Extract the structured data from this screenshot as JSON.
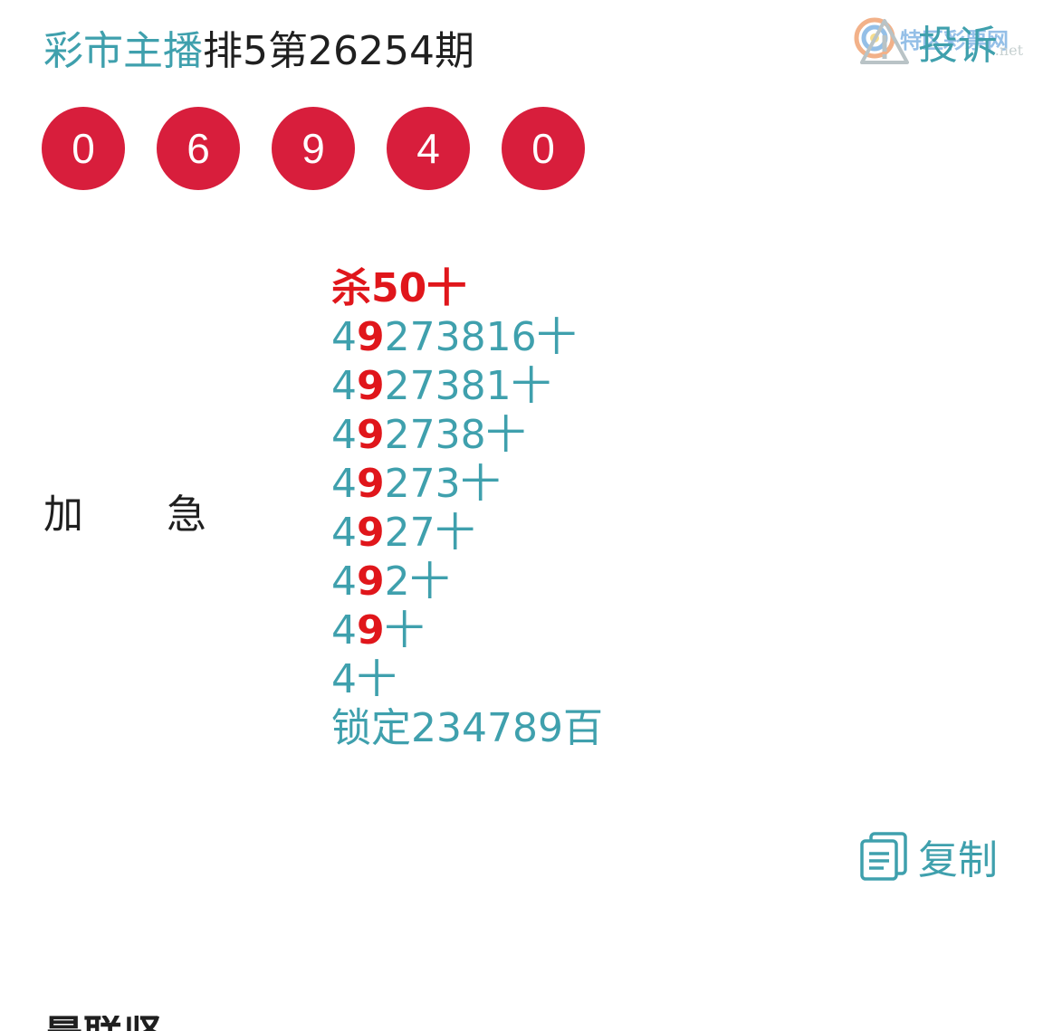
{
  "header": {
    "brand": "彩市主播",
    "issue": "排5第26254期"
  },
  "actions": {
    "complain_label": "投诉",
    "copy_label": "复制"
  },
  "watermark": {
    "text": "特区彩票网",
    "sub": ".net"
  },
  "balls": [
    "0",
    "6",
    "9",
    "4",
    "0"
  ],
  "colors": {
    "accent": "#3fa0ad",
    "ball": "#d81e3c",
    "highlight": "#e0161b"
  },
  "side_label": {
    "first": "加",
    "second": "急"
  },
  "content": {
    "kill_line": "杀50十",
    "lines": [
      {
        "pre": "4",
        "hi": "9",
        "rest": "273816十"
      },
      {
        "pre": "4",
        "hi": "9",
        "rest": "27381十"
      },
      {
        "pre": "4",
        "hi": "9",
        "rest": "2738十"
      },
      {
        "pre": "4",
        "hi": "9",
        "rest": "273十"
      },
      {
        "pre": "4",
        "hi": "9",
        "rest": "27十"
      },
      {
        "pre": "4",
        "hi": "9",
        "rest": "2十"
      },
      {
        "pre": "4",
        "hi": "9",
        "rest": "十"
      },
      {
        "pre": "4",
        "hi": "",
        "rest": "十"
      }
    ],
    "lock_line": "锁定234789百"
  },
  "footer": {
    "cut_text": "晨联坚"
  }
}
